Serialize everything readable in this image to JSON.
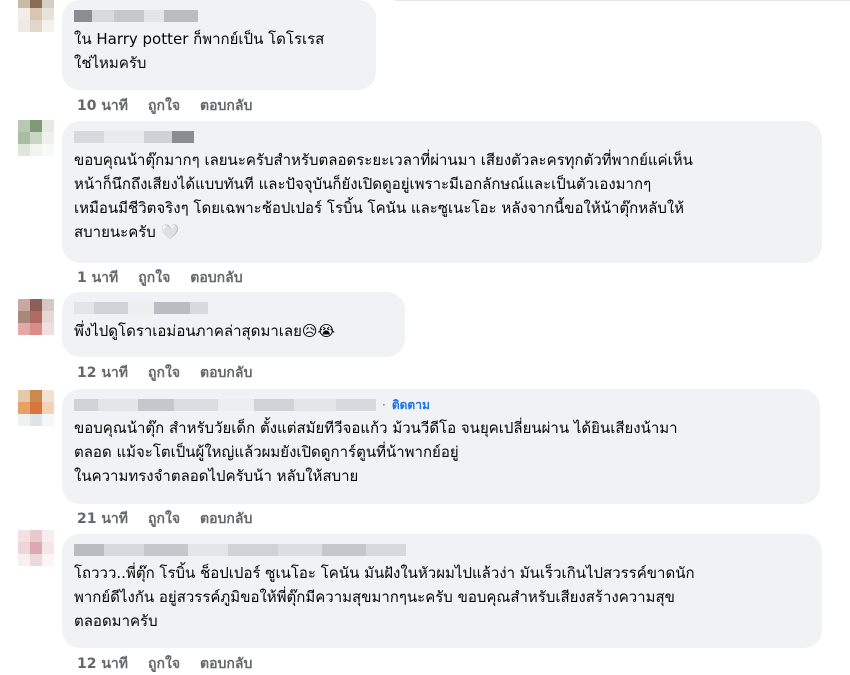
{
  "comments": [
    {
      "text": "ใน Harry potter ก็พากย์เป็น โดโรเรส\nใช่ไหมครับ",
      "time": "10 นาที",
      "like": "ถูกใจ",
      "reply": "ตอบกลับ",
      "avatar_colors": [
        "#c9b9a6",
        "#8a6d52",
        "#d8cfc4",
        "#f2ede6",
        "#d9c6b2",
        "#e9e2da",
        "#efe9e3",
        "#e0d6cc",
        "#f5f1ec"
      ]
    },
    {
      "text": "ขอบคุณน้าตุ๊กมากๆ เลยนะครับสำหรับตลอดระยะเวลาที่ผ่านมา เสียงตัวละครทุกตัวที่พากย์แค่เห็น\nหน้าก็นึกถึงเสียงได้แบบทันที และปัจจุบันก็ยังเปิดดูอยู่เพราะมีเอกลักษณ์และเป็นตัวเองมากๆ\nเหมือนมีชีวิตจริงๆ โดยเฉพาะช้อปเปอร์ โรบิ้น โคนัน และซูเนะโอะ หลังจากนี้ขอให้น้าตุ๊กหลับให้\nสบายนะครับ 🤍",
      "time": "1 นาที",
      "like": "ถูกใจ",
      "reply": "ตอบกลับ",
      "avatar_colors": [
        "#b8c9b3",
        "#7f9a78",
        "#e4ece2",
        "#a9bca4",
        "#c9d6c5",
        "#eef2ec",
        "#dfe7dc",
        "#f1f4ef",
        "#f8faf7"
      ]
    },
    {
      "text": "พึ่งไปดูโดราเอม่อนภาคล่าสุดมาเลย😥😭",
      "time": "12 นาที",
      "like": "ถูกใจ",
      "reply": "ตอบกลับ",
      "avatar_colors": [
        "#c9a8a2",
        "#8c5f58",
        "#d9c5c2",
        "#a8877f",
        "#b06a62",
        "#e8d8d5",
        "#e2aaa6",
        "#d98d88",
        "#f1dede"
      ]
    },
    {
      "text": "ขอบคุณน้าตุ๊ก สำหรับวัยเด็ก ตั้งแต่สมัยทีวีจอแก้ว ม้วนวีดีโอ จนยุคเปลี่ยนผ่าน ได้ยินเสียงน้ามา\nตลอด แม้จะโตเป็นผู้ใหญ่แล้วผมยังเปิดดูการ์ตูนที่น้าพากย์อยู่\nในความทรงจำตลอดไปครับน้า หลับให้สบาย",
      "time": "21 นาที",
      "like": "ถูกใจ",
      "reply": "ตอบกลับ",
      "follow": "ติดตาม",
      "dot": "·",
      "avatar_colors": [
        "#e6c9a8",
        "#c98a4f",
        "#f3e2cf",
        "#e9a066",
        "#d9743a",
        "#f4d2b4",
        "#eef0f2",
        "#dfe3e7",
        "#f6f7f9"
      ]
    },
    {
      "text": "โถววว..พี่ตุ๊ก โรบิ้น ช็อปเปอร์ ซูเนโอะ โคนัน มันฝังในหัวผมไปแล้วง่า มันเร็วเกินไปสวรรค์ขาดนัก\nพากย์ดีไงกัน อยู่สวรรค์ภูมิขอให้พี่ตุ๊กมีความสุขมากๆนะครับ ขอบคุณสำหรับเสียงสร้างความสุข\nตลอดมาครับ",
      "time": "12 นาที",
      "like": "ถูกใจ",
      "reply": "ตอบกลับ",
      "avatar_colors": [
        "#f2e0e2",
        "#e9c9cd",
        "#f7eeef",
        "#f0d5d8",
        "#dca9ae",
        "#f5e6e8",
        "#f8eff0",
        "#efd8db",
        "#fbf5f6"
      ]
    }
  ]
}
